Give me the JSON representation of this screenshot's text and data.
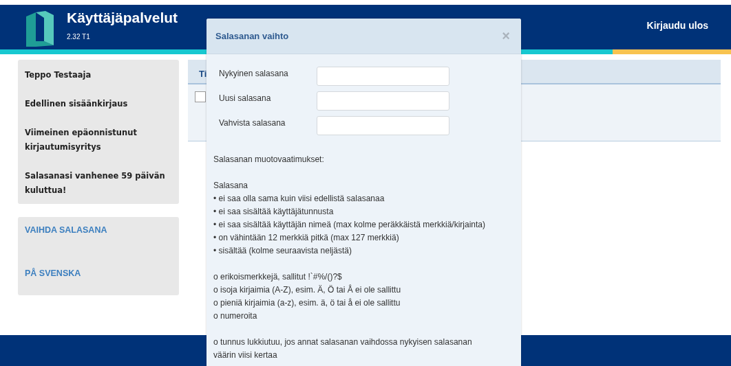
{
  "header": {
    "title": "Käyttäjäpalvelut",
    "version": "2.32 T1",
    "logout": "Kirjaudu ulos"
  },
  "sidebar": {
    "info": [
      "Teppo Testaaja",
      "Edellinen sisäänkirjaus",
      "Viimeinen epäonnistunut kirjautumisyritys",
      "Salasanasi vanhenee 59 päivän kuluttua!"
    ],
    "links": [
      "VAIHDA SALASANA",
      "PÅ SVENSKA"
    ]
  },
  "content_panel": {
    "column_1": "Ti",
    "checkbox": {
      "checked": false
    }
  },
  "modal": {
    "title": "Salasanan vaihto",
    "close": "×",
    "fields": [
      {
        "label": "Nykyinen salasana"
      },
      {
        "label": "Uusi salasana"
      },
      {
        "label": "Vahvista salasana"
      }
    ],
    "paragraphs": [
      [
        "Salasanan muotovaatimukset:"
      ],
      [
        "Salasana",
        "• ei saa olla sama kuin viisi edellistä salasanaa",
        "• ei saa sisältää käyttäjätunnusta",
        "• ei saa sisältää käyttäjän nimeä (max kolme peräkkäistä merkkiä/kirjainta)",
        "• on vähintään 12 merkkiä pitkä (max 127 merkkiä)",
        "• sisältää (kolme seuraavista neljästä)"
      ],
      [
        "o erikoismerkkejä, sallitut !`#%/()?$",
        "o isoja kirjaimia (A-Z), esim. Ä, Ö tai Å ei ole sallittu",
        "o pieniä kirjaimia (a-z), esim. ä, ö tai å ei ole sallittu",
        "o numeroita"
      ],
      [
        "o tunnus lukkiutuu, jos annat salasanan vaihdossa nykyisen salasanan väärin viisi kertaa"
      ]
    ]
  }
}
